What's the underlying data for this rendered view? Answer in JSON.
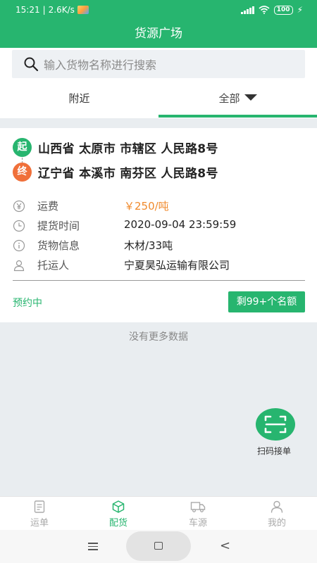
{
  "status_bar": {
    "time": "15:21",
    "network_speed": "2.6K/s",
    "battery": "100",
    "icons": [
      "signal-icon",
      "wifi-icon",
      "battery-icon",
      "charging-icon"
    ]
  },
  "title": "货源广场",
  "search": {
    "placeholder": "输入货物名称进行搜索"
  },
  "tabs": [
    {
      "label": "附近"
    },
    {
      "label": "全部"
    }
  ],
  "card": {
    "start_badge": "起",
    "start_address": "山西省 太原市 市辖区 人民路8号",
    "end_badge": "终",
    "end_address": "辽宁省 本溪市 南芬区 人民路8号",
    "fields": [
      {
        "label": "运费",
        "value": "￥250/吨",
        "icon": "yen-icon"
      },
      {
        "label": "提货时间",
        "value": "2020-09-04 23:59:59",
        "icon": "clock-icon"
      },
      {
        "label": "货物信息",
        "value": "木材/33吨",
        "icon": "info-icon"
      },
      {
        "label": "托运人",
        "value": "宁夏昊弘运输有限公司",
        "icon": "user-icon"
      }
    ],
    "status": "预约中",
    "quota": "剩99+个名额"
  },
  "no_more_text": "没有更多数据",
  "scan_button": {
    "label": "扫码接单"
  },
  "bottom_nav": [
    {
      "label": "运单",
      "icon": "document-icon"
    },
    {
      "label": "配货",
      "icon": "box-icon",
      "active": true
    },
    {
      "label": "车源",
      "icon": "truck-icon"
    },
    {
      "label": "我的",
      "icon": "person-icon"
    }
  ],
  "colors": {
    "primary": "#27b56f",
    "price": "#f08a2c",
    "end_badge": "#f0703a"
  }
}
